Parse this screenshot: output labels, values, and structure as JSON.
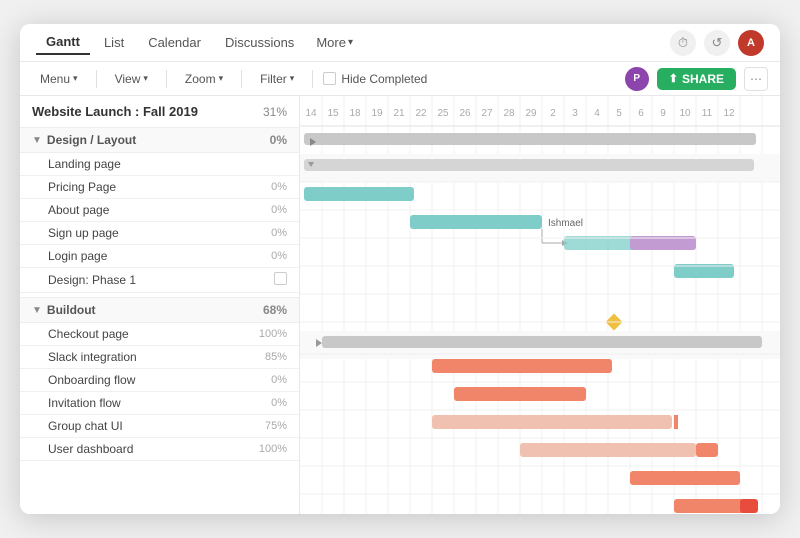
{
  "app": {
    "title": "Website Launch : Fall 2019"
  },
  "nav": {
    "tabs": [
      {
        "id": "gantt",
        "label": "Gantt",
        "active": true
      },
      {
        "id": "list",
        "label": "List",
        "active": false
      },
      {
        "id": "calendar",
        "label": "Calendar",
        "active": false
      },
      {
        "id": "discussions",
        "label": "Discussions",
        "active": false
      },
      {
        "id": "more",
        "label": "More",
        "active": false
      }
    ]
  },
  "toolbar": {
    "menu_label": "Menu",
    "view_label": "View",
    "zoom_label": "Zoom",
    "filter_label": "Filter",
    "hide_completed_label": "Hide Completed",
    "share_label": "SHARE"
  },
  "project": {
    "title": "Website Launch : Fall 2019",
    "percent": "31%",
    "groups": [
      {
        "id": "design",
        "label": "Design / Layout",
        "percent": "0%",
        "collapsed": false,
        "tasks": [
          {
            "id": "landing",
            "label": "Landing page",
            "percent": ""
          },
          {
            "id": "pricing",
            "label": "Pricing Page",
            "percent": "0%"
          },
          {
            "id": "about",
            "label": "About page",
            "percent": "0%"
          },
          {
            "id": "signup",
            "label": "Sign up page",
            "percent": "0%"
          },
          {
            "id": "login",
            "label": "Login page",
            "percent": "0%"
          },
          {
            "id": "design_phase",
            "label": "Design: Phase 1",
            "percent": ""
          }
        ]
      },
      {
        "id": "buildout",
        "label": "Buildout",
        "percent": "68%",
        "collapsed": false,
        "tasks": [
          {
            "id": "checkout",
            "label": "Checkout page",
            "percent": "100%"
          },
          {
            "id": "slack",
            "label": "Slack integration",
            "percent": "85%"
          },
          {
            "id": "onboarding",
            "label": "Onboarding flow",
            "percent": "0%"
          },
          {
            "id": "invitation",
            "label": "Invitation flow",
            "percent": "0%"
          },
          {
            "id": "group_chat",
            "label": "Group chat UI",
            "percent": "75%"
          },
          {
            "id": "user_dashboard",
            "label": "User dashboard",
            "percent": "100%"
          }
        ]
      }
    ]
  },
  "dates": [
    "14",
    "15",
    "18",
    "19",
    "21",
    "22",
    "25",
    "26",
    "27",
    "28",
    "29",
    "2",
    "3",
    "4",
    "5",
    "6",
    "9",
    "10",
    "11",
    "12"
  ],
  "colors": {
    "bar_gray": "#b0b0b0",
    "bar_teal": "#7ecdc8",
    "bar_purple": "#c39bd3",
    "bar_orange": "#f0856a",
    "bar_orange_light": "#f0c0b0",
    "bar_diamond": "#f0c040",
    "share_btn": "#27ae60",
    "avatar": "#8e44ad"
  },
  "icons": {
    "clock": "⏱",
    "share": "↑",
    "chevron_down": "▾",
    "triangle_right": "▶",
    "triangle_down": "▼"
  }
}
